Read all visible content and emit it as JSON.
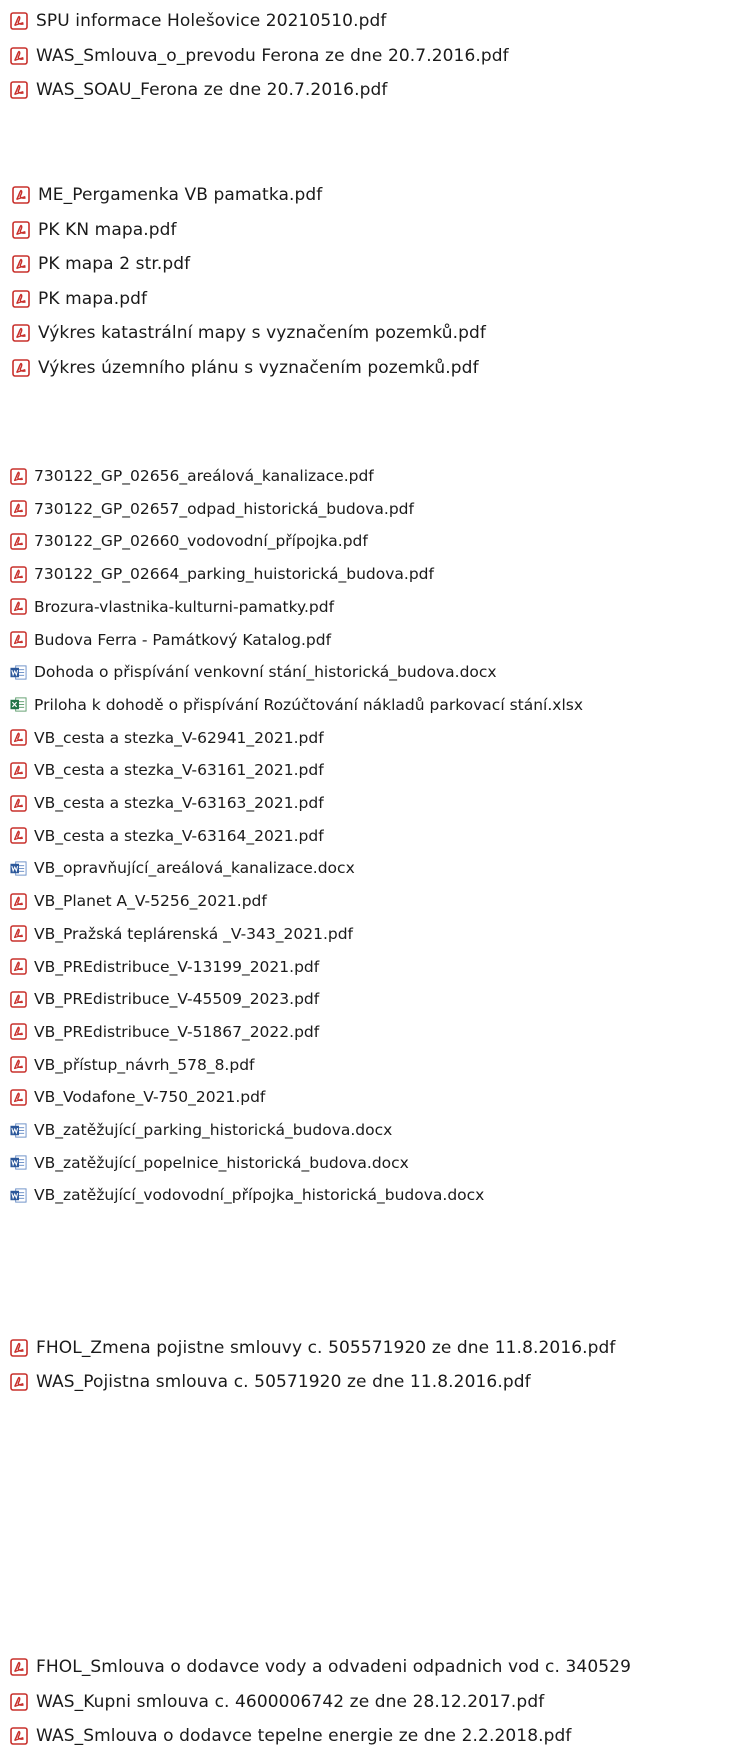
{
  "groups": [
    {
      "files": [
        {
          "name": "SPU informace Holešovice 20210510.pdf",
          "icon": "pdf-icon"
        },
        {
          "name": "WAS_Smlouva_o_prevodu Ferona ze dne 20.7.2016.pdf",
          "icon": "pdf-icon"
        },
        {
          "name": "WAS_SOAU_Ferona ze dne 20.7.2016.pdf",
          "icon": "pdf-icon"
        }
      ]
    },
    {
      "files": [
        {
          "name": "ME_Pergamenka VB pamatka.pdf",
          "icon": "pdf-icon"
        },
        {
          "name": "PK KN mapa.pdf",
          "icon": "pdf-icon"
        },
        {
          "name": "PK mapa 2 str.pdf",
          "icon": "pdf-icon"
        },
        {
          "name": "PK mapa.pdf",
          "icon": "pdf-icon"
        },
        {
          "name": "Výkres katastrální mapy s vyznačením pozemků.pdf",
          "icon": "pdf-icon"
        },
        {
          "name": "Výkres územního plánu s vyznačením pozemků.pdf",
          "icon": "pdf-icon"
        }
      ]
    },
    {
      "files": [
        {
          "name": "730122_GP_02656_areálová_kanalizace.pdf",
          "icon": "pdf-icon"
        },
        {
          "name": "730122_GP_02657_odpad_historická_budova.pdf",
          "icon": "pdf-icon"
        },
        {
          "name": "730122_GP_02660_vodovodní_přípojka.pdf",
          "icon": "pdf-icon"
        },
        {
          "name": "730122_GP_02664_parking_huistorická_budova.pdf",
          "icon": "pdf-icon"
        },
        {
          "name": "Brozura-vlastnika-kulturni-pamatky.pdf",
          "icon": "pdf-icon"
        },
        {
          "name": "Budova Ferra - Památkový Katalog.pdf",
          "icon": "pdf-icon"
        },
        {
          "name": "Dohoda o přispívání venkovní stání_historická_budova.docx",
          "icon": "word-icon"
        },
        {
          "name": "Priloha k dohodě o přispívání Rozúčtování nákladů parkovací stání.xlsx",
          "icon": "excel-icon"
        },
        {
          "name": "VB_cesta a stezka_V-62941_2021.pdf",
          "icon": "pdf-icon"
        },
        {
          "name": "VB_cesta a stezka_V-63161_2021.pdf",
          "icon": "pdf-icon"
        },
        {
          "name": "VB_cesta a stezka_V-63163_2021.pdf",
          "icon": "pdf-icon"
        },
        {
          "name": "VB_cesta a stezka_V-63164_2021.pdf",
          "icon": "pdf-icon"
        },
        {
          "name": "VB_opravňující_areálová_kanalizace.docx",
          "icon": "word-icon"
        },
        {
          "name": "VB_Planet A_V-5256_2021.pdf",
          "icon": "pdf-icon"
        },
        {
          "name": "VB_Pražská teplárenská _V-343_2021.pdf",
          "icon": "pdf-icon"
        },
        {
          "name": "VB_PREdistribuce_V-13199_2021.pdf",
          "icon": "pdf-icon"
        },
        {
          "name": "VB_PREdistribuce_V-45509_2023.pdf",
          "icon": "pdf-icon"
        },
        {
          "name": "VB_PREdistribuce_V-51867_2022.pdf",
          "icon": "pdf-icon"
        },
        {
          "name": "VB_přístup_návrh_578_8.pdf",
          "icon": "pdf-icon"
        },
        {
          "name": "VB_Vodafone_V-750_2021.pdf",
          "icon": "pdf-icon"
        },
        {
          "name": "VB_zatěžující_parking_historická_budova.docx",
          "icon": "word-icon"
        },
        {
          "name": "VB_zatěžující_popelnice_historická_budova.docx",
          "icon": "word-icon"
        },
        {
          "name": "VB_zatěžující_vodovodní_přípojka_historická_budova.docx",
          "icon": "word-icon"
        }
      ]
    },
    {
      "files": [
        {
          "name": "FHOL_Zmena pojistne smlouvy c. 505571920 ze dne 11.8.2016.pdf",
          "icon": "pdf-icon"
        },
        {
          "name": "WAS_Pojistna smlouva c. 50571920 ze dne 11.8.2016.pdf",
          "icon": "pdf-icon"
        }
      ]
    },
    {
      "files": [
        {
          "name": "FHOL_Smlouva o dodavce vody a odvadeni odpadnich vod c. 340529",
          "icon": "pdf-icon"
        },
        {
          "name": "WAS_Kupni smlouva c. 4600006742 ze dne 28.12.2017.pdf",
          "icon": "pdf-icon"
        },
        {
          "name": "WAS_Smlouva o dodavce tepelne energie ze dne 2.2.2018.pdf",
          "icon": "pdf-icon"
        }
      ]
    }
  ]
}
